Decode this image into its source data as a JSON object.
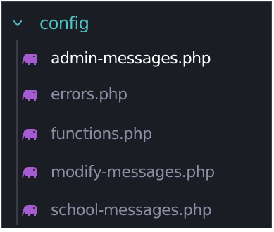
{
  "explorer": {
    "folder": {
      "name": "config",
      "expanded": true,
      "icon": "chevron-down-icon"
    },
    "files": [
      {
        "name": "admin-messages.php",
        "icon": "php-elephant-icon",
        "active": true
      },
      {
        "name": "errors.php",
        "icon": "php-elephant-icon",
        "active": false
      },
      {
        "name": "functions.php",
        "icon": "php-elephant-icon",
        "active": false
      },
      {
        "name": "modify-messages.php",
        "icon": "php-elephant-icon",
        "active": false
      },
      {
        "name": "school-messages.php",
        "icon": "php-elephant-icon",
        "active": false
      }
    ]
  },
  "colors": {
    "background": "#1b1d24",
    "folder_text": "#4fc3c7",
    "file_text": "#8e8fa6",
    "active_file_text": "#ffffff",
    "php_icon": "#a45cd0"
  }
}
